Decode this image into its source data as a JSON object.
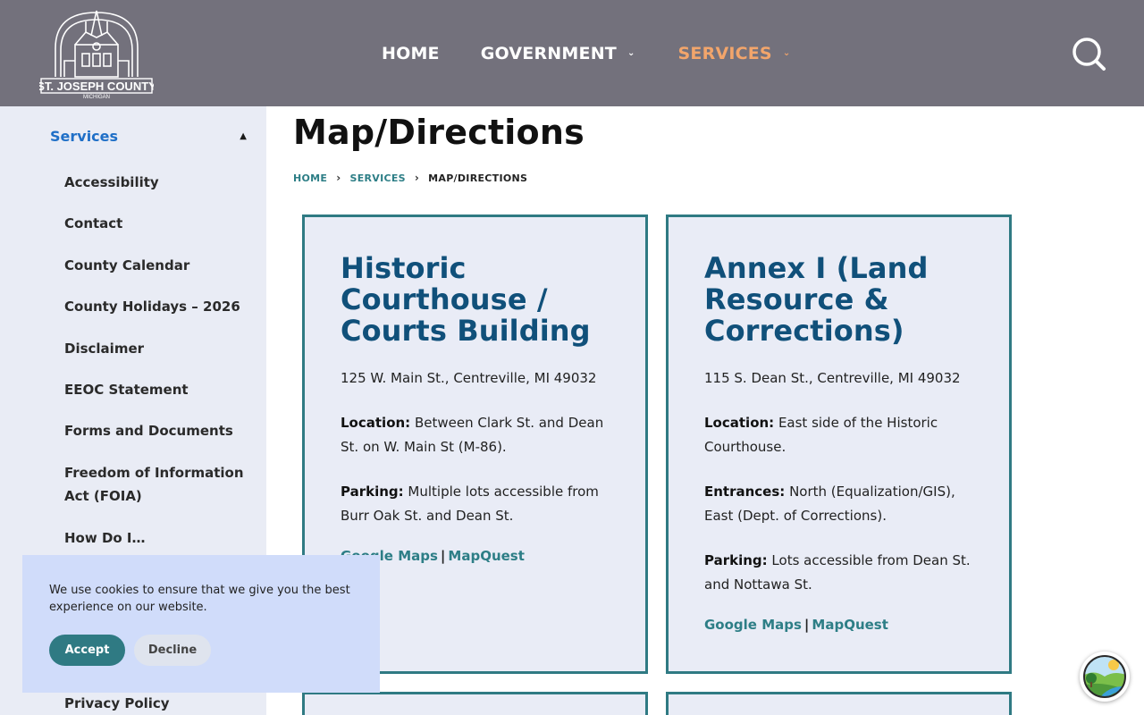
{
  "header": {
    "logo_text": "ST. JOSEPH COUNTY",
    "logo_subtext": "MICHIGAN",
    "nav": [
      {
        "label": "HOME"
      },
      {
        "label": "GOVERNMENT",
        "has_dropdown": true
      },
      {
        "label": "SERVICES",
        "has_dropdown": true,
        "active": true
      }
    ],
    "search_icon": "search-icon"
  },
  "sidebar": {
    "heading": "Services",
    "items": [
      {
        "label": "Accessibility"
      },
      {
        "label": "Contact"
      },
      {
        "label": "County Calendar"
      },
      {
        "label": "County Holidays – 2026"
      },
      {
        "label": "Disclaimer"
      },
      {
        "label": "EEOC Statement"
      },
      {
        "label": "Forms and Documents"
      },
      {
        "label": "Freedom of Information Act (FOIA)"
      },
      {
        "label": "How Do I…"
      },
      {
        "label": "Privacy Policy"
      }
    ]
  },
  "main": {
    "title": "Map/Directions",
    "breadcrumb": {
      "home": "HOME",
      "services": "SERVICES",
      "current": "MAP/DIRECTIONS"
    },
    "cards": [
      {
        "title": "Historic Courthouse / Courts Building",
        "address": "125 W. Main St., Centreville, MI 49032",
        "fields": [
          {
            "label": "Location:",
            "text": " Between Clark St. and Dean St. on W. Main St (M-86)."
          },
          {
            "label": "Parking:",
            "text": " Multiple lots accessible from Burr Oak St. and Dean St."
          }
        ],
        "link_google": "Google Maps",
        "link_mapquest": "MapQuest"
      },
      {
        "title": "Annex I (Land Resource & Corrections)",
        "address": "115 S. Dean St., Centreville, MI 49032",
        "fields": [
          {
            "label": "Location:",
            "text": " East side of the Historic Courthouse."
          },
          {
            "label": "Entrances:",
            "text": " North (Equalization/GIS), East (Dept. of Corrections)."
          },
          {
            "label": "Parking:",
            "text": " Lots accessible from Dean St. and Nottawa St."
          }
        ],
        "link_google": "Google Maps",
        "link_mapquest": "MapQuest"
      }
    ]
  },
  "cookie": {
    "text": "We use cookies to ensure that we give you the best experience on our website.",
    "accept": "Accept",
    "decline": "Decline"
  },
  "colors": {
    "header_bg": "#73717c",
    "accent_orange": "#f2a56b",
    "teal": "#2f7a83",
    "card_title": "#10507a",
    "sidebar_bg": "#e9ecf5",
    "sidebar_heading": "#1f6fc7",
    "cookie_bg": "#d0dcfa"
  }
}
